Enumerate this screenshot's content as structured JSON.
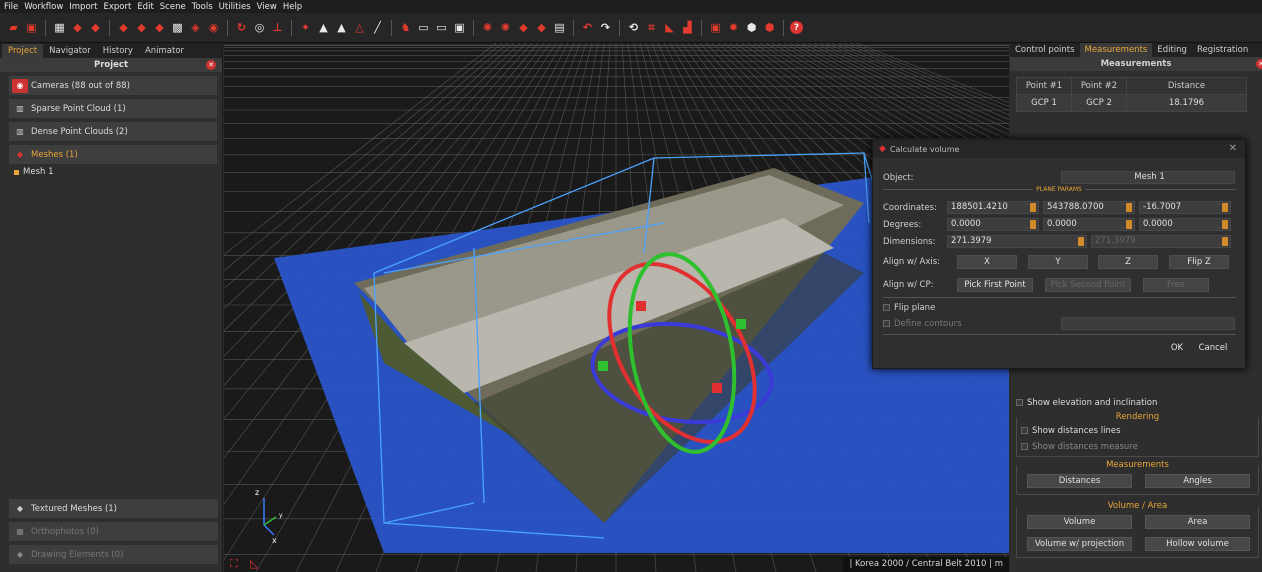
{
  "menu": [
    "File",
    "Workflow",
    "Import",
    "Export",
    "Edit",
    "Scene",
    "Tools",
    "Utilities",
    "View",
    "Help"
  ],
  "left": {
    "tabs": [
      "Project",
      "Navigator",
      "History",
      "Animator"
    ],
    "header": "Project",
    "items": [
      {
        "label": "Cameras (88 out of 88)",
        "state": "normal",
        "icon": "camera-icon"
      },
      {
        "label": "Sparse Point Cloud (1)",
        "state": "normal",
        "icon": "sparse-cloud-icon"
      },
      {
        "label": "Dense Point Clouds (2)",
        "state": "normal",
        "icon": "dense-cloud-icon"
      },
      {
        "label": "Meshes (1)",
        "state": "highlight",
        "icon": "mesh-icon"
      }
    ],
    "mesh_child": "Mesh 1",
    "bottom_items": [
      {
        "label": "Textured Meshes (1)",
        "state": "normal",
        "icon": "textured-mesh-icon"
      },
      {
        "label": "Orthophotos (0)",
        "state": "disabled",
        "icon": "orthophoto-icon"
      },
      {
        "label": "Drawing Elements (0)",
        "state": "disabled",
        "icon": "drawing-icon"
      }
    ]
  },
  "viewport": {
    "status": "| Korea 2000 / Central Belt 2010  | m",
    "axis": {
      "z": "z",
      "x": "x",
      "y": "y"
    }
  },
  "right": {
    "tabs": [
      "Control points",
      "Measurements",
      "Editing",
      "Registration"
    ],
    "header": "Measurements",
    "table": {
      "headers": [
        "Point #1",
        "Point #2",
        "Distance"
      ],
      "rows": [
        [
          "GCP 1",
          "GCP 2",
          "18.1796"
        ]
      ]
    },
    "show_elevation": "Show elevation and inclination",
    "rendering": {
      "title": "Rendering",
      "lines": "Show distances lines",
      "measure": "Show distances measure"
    },
    "measurements": {
      "title": "Measurements",
      "distances": "Distances",
      "angles": "Angles"
    },
    "volume": {
      "title": "Volume / Area",
      "volume": "Volume",
      "area": "Area",
      "proj": "Volume w/ projection",
      "hollow": "Hollow volume"
    }
  },
  "dialog": {
    "title": "Calculate volume",
    "object_label": "Object:",
    "object_value": "Mesh 1",
    "section": "PLANE PARAMS",
    "coord_label": "Coordinates:",
    "coords": [
      "188501.4210",
      "543788.0700",
      "-16.7007"
    ],
    "deg_label": "Degrees:",
    "degrees": [
      "0.0000",
      "0.0000",
      "0.0000"
    ],
    "dim_label": "Dimensions:",
    "dims": [
      "271.3979",
      "271.3979"
    ],
    "align_axis_label": "Align w/ Axis:",
    "axis_btns": [
      "X",
      "Y",
      "Z",
      "Flip Z"
    ],
    "align_cp_label": "Align w/ CP:",
    "cp_btns": [
      "Pick First Point",
      "Pick Second Point",
      "Free"
    ],
    "flip_plane": "Flip plane",
    "define_contours": "Define contours",
    "ok": "OK",
    "cancel": "Cancel"
  }
}
